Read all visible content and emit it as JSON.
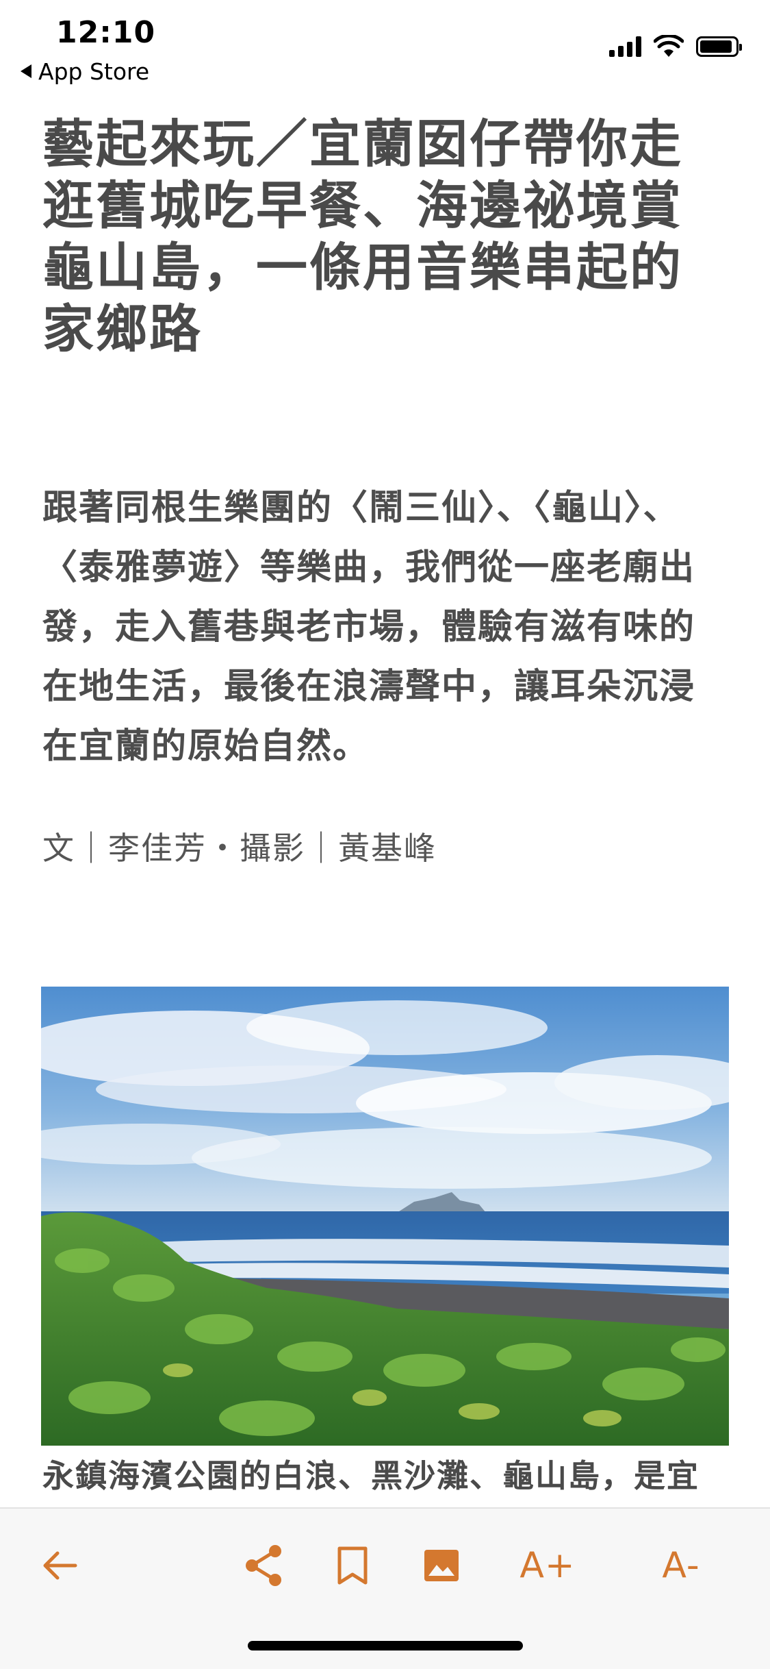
{
  "status_bar": {
    "time": "12:10",
    "back_app": "App Store"
  },
  "article": {
    "title": "藝起來玩／宜蘭囡仔帶你走逛舊城吃早餐、海邊祕境賞龜山島，一條用音樂串起的家鄉路",
    "lede": "跟著同根生樂團的〈鬧三仙〉、〈龜山〉、〈泰雅夢遊〉等樂曲，我們從一座老廟出發，走入舊巷與老市場，體驗有滋有味的在地生活，最後在浪濤聲中，讓耳朵沉浸在宜蘭的原始自然。",
    "byline": "文｜李佳芳・攝影｜黃基峰",
    "photo_caption": "永鎮海濱公園的白浪、黑沙灘、龜山島，是宜"
  },
  "toolbar": {
    "back_icon": "arrow-left-icon",
    "share_icon": "share-icon",
    "bookmark_icon": "bookmark-icon",
    "image_icon": "image-icon",
    "font_increase": "A+",
    "font_decrease": "A-"
  },
  "colors": {
    "accent": "#d4782f",
    "title_text": "#4a4a4a",
    "toolbar_bg": "#f7f7f7"
  }
}
